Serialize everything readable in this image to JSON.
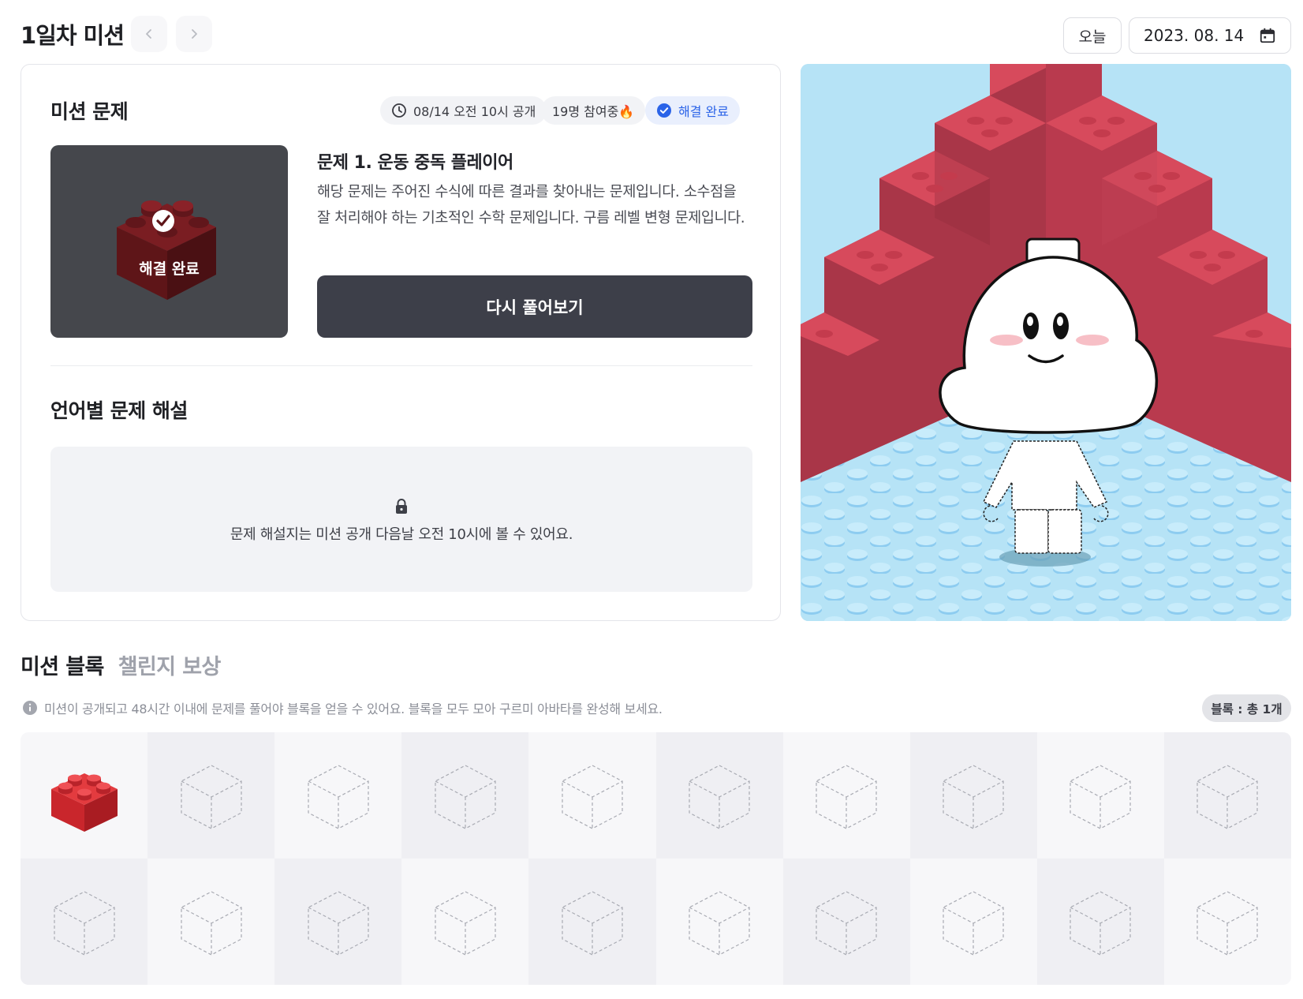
{
  "header": {
    "title": "1일차 미션",
    "today_label": "오늘",
    "date": "2023. 08. 14"
  },
  "mission": {
    "section_title": "미션 문제",
    "open_time": "08/14 오전 10시 공개",
    "participants": "19명 참여중🔥",
    "solved_status": "해결 완료",
    "thumbnail_label": "해결 완료",
    "problem_title": "문제 1. 운동 중독 플레이어",
    "problem_description": "해당 문제는 주어진 수식에 따른 결과를 찾아내는 문제입니다. 소수점을 잘 처리해야 하는 기초적인 수학 문제입니다. 구름 레벨 변형 문제입니다.",
    "retry_label": "다시 풀어보기"
  },
  "solutions": {
    "section_title": "언어별 문제 해설",
    "locked_message": "문제 해설지는 미션 공개 다음날 오전 10시에 볼 수 있어요."
  },
  "blocks": {
    "tabs": [
      "미션 블록",
      "챌린지 보상"
    ],
    "info": "미션이 공개되고 48시간 이내에 문제를 풀어야 블록을 얻을 수 있어요. 블록을 모두 모아 구르미 아바타를 완성해 보세요.",
    "count_label": "블록 : 총 1개",
    "collected_count": 1,
    "total_slots": 20
  },
  "colors": {
    "solved_blue": "#2a63e8",
    "brick_red": "#d33a3f",
    "dark_button": "#3d3f49",
    "sky": "#b6e3f6"
  }
}
